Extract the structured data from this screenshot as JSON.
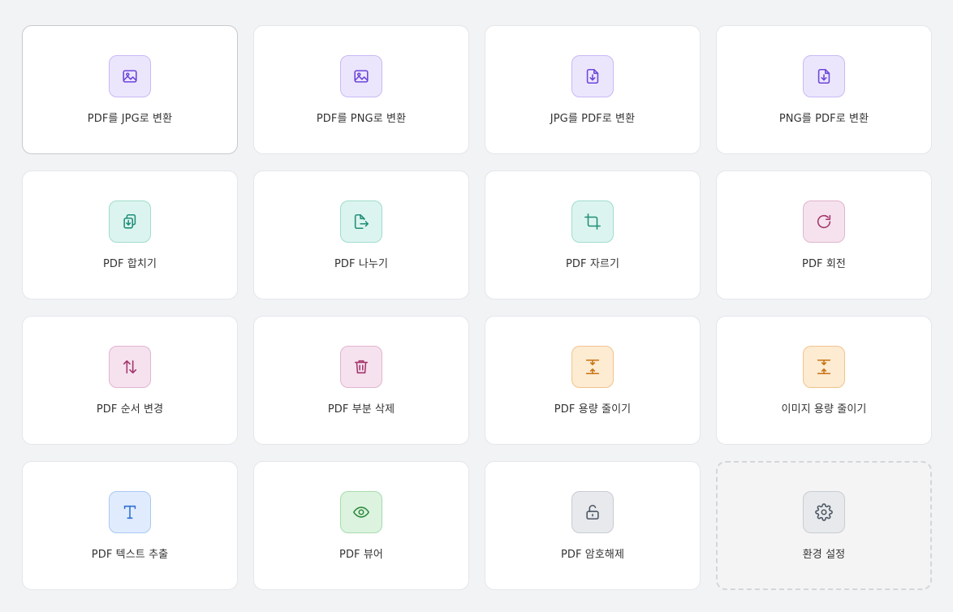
{
  "tools": [
    {
      "label": "PDF를 JPG로 변환",
      "icon": "image-icon"
    },
    {
      "label": "PDF를 PNG로 변환",
      "icon": "image-icon"
    },
    {
      "label": "JPG를 PDF로 변환",
      "icon": "file-download-icon"
    },
    {
      "label": "PNG를 PDF로 변환",
      "icon": "file-download-icon"
    },
    {
      "label": "PDF 합치기",
      "icon": "merge-files-icon"
    },
    {
      "label": "PDF 나누기",
      "icon": "file-export-icon"
    },
    {
      "label": "PDF 자르기",
      "icon": "crop-icon"
    },
    {
      "label": "PDF 회전",
      "icon": "rotate-icon"
    },
    {
      "label": "PDF 순서 변경",
      "icon": "arrows-up-down-icon"
    },
    {
      "label": "PDF 부분 삭제",
      "icon": "trash-icon"
    },
    {
      "label": "PDF 용량 줄이기",
      "icon": "compress-icon"
    },
    {
      "label": "이미지 용량 줄이기",
      "icon": "compress-icon"
    },
    {
      "label": "PDF 텍스트 추출",
      "icon": "text-icon"
    },
    {
      "label": "PDF 뷰어",
      "icon": "eye-icon"
    },
    {
      "label": "PDF 암호해제",
      "icon": "unlock-icon"
    },
    {
      "label": "환경 설정",
      "icon": "gear-icon"
    }
  ],
  "colors": {
    "background": "#f2f3f5",
    "purple": "#6b46d9",
    "teal": "#1f8f78",
    "pink": "#a3356b",
    "orange": "#c87312",
    "blue": "#2e6fd3",
    "green": "#2f8b3f",
    "gray": "#4b5563"
  }
}
